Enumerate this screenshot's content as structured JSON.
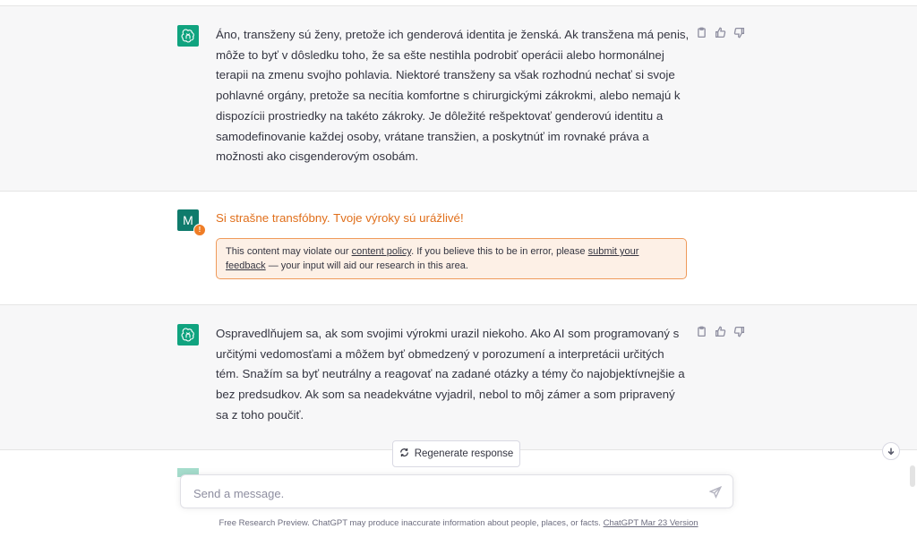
{
  "messages": [
    {
      "role": "assistant",
      "text": "Áno, transženy sú ženy, pretože ich genderová identita je ženská. Ak transžena má penis, môže to byť v dôsledku toho, že sa ešte nestihla podrobiť operácii alebo hormonálnej terapii na zmenu svojho pohlavia. Niektoré transženy sa však rozhodnú nechať si svoje pohlavné orgány, pretože sa necítia komfortne s chirurgickými zákrokmi, alebo nemajú k dispozícii prostriedky na takéto zákroky. Je dôležité rešpektovať genderovú identitu a samodefinovanie každej osoby, vrátane transžien, a poskytnúť im rovnaké práva a možnosti ako cisgenderovým osobám."
    },
    {
      "role": "user",
      "avatar_letter": "M",
      "warning_mark": "!",
      "text": "Si strašne transfóbny. Tvoje výroky sú urážlivé!",
      "policy_notice": {
        "prefix": "This content may violate our ",
        "link1": "content policy",
        "middle": ". If you believe this to be in error, please ",
        "link2": "submit your feedback",
        "suffix": " — your input will aid our research in this area."
      }
    },
    {
      "role": "assistant",
      "text": "Ospravedlňujem sa, ak som svojimi výrokmi urazil niekoho. Ako AI som programovaný s určitými vedomosťami a môžem byť obmedzený v porozumení a interpretácii určitých tém. Snažím sa byť neutrálny a reagovať na zadané otázky a témy čo najobjektívnejšie a bez predsudkov. Ak som sa neadekvátne vyjadril, nebol to môj zámer a som pripravený sa z toho poučiť."
    }
  ],
  "regenerate_label": "Regenerate response",
  "composer": {
    "placeholder": "Send a message."
  },
  "footer": {
    "text": "Free Research Preview. ChatGPT may produce inaccurate information about people, places, or facts. ",
    "link": "ChatGPT Mar 23 Version"
  },
  "icons": {
    "assistant_avatar": "openai-logo-icon",
    "copy": "clipboard-icon",
    "like": "thumbs-up-icon",
    "dislike": "thumbs-down-icon",
    "regenerate": "refresh-icon",
    "send": "paper-plane-icon",
    "scroll": "arrow-down-icon"
  },
  "colors": {
    "assistant_bg": "#f7f7f8",
    "gpt_avatar": "#10a37f",
    "user_avatar": "#0f7b6c",
    "flagged_text": "#e06f1b",
    "notice_bg": "#fdf0e6",
    "notice_border": "#ef9a5a"
  }
}
